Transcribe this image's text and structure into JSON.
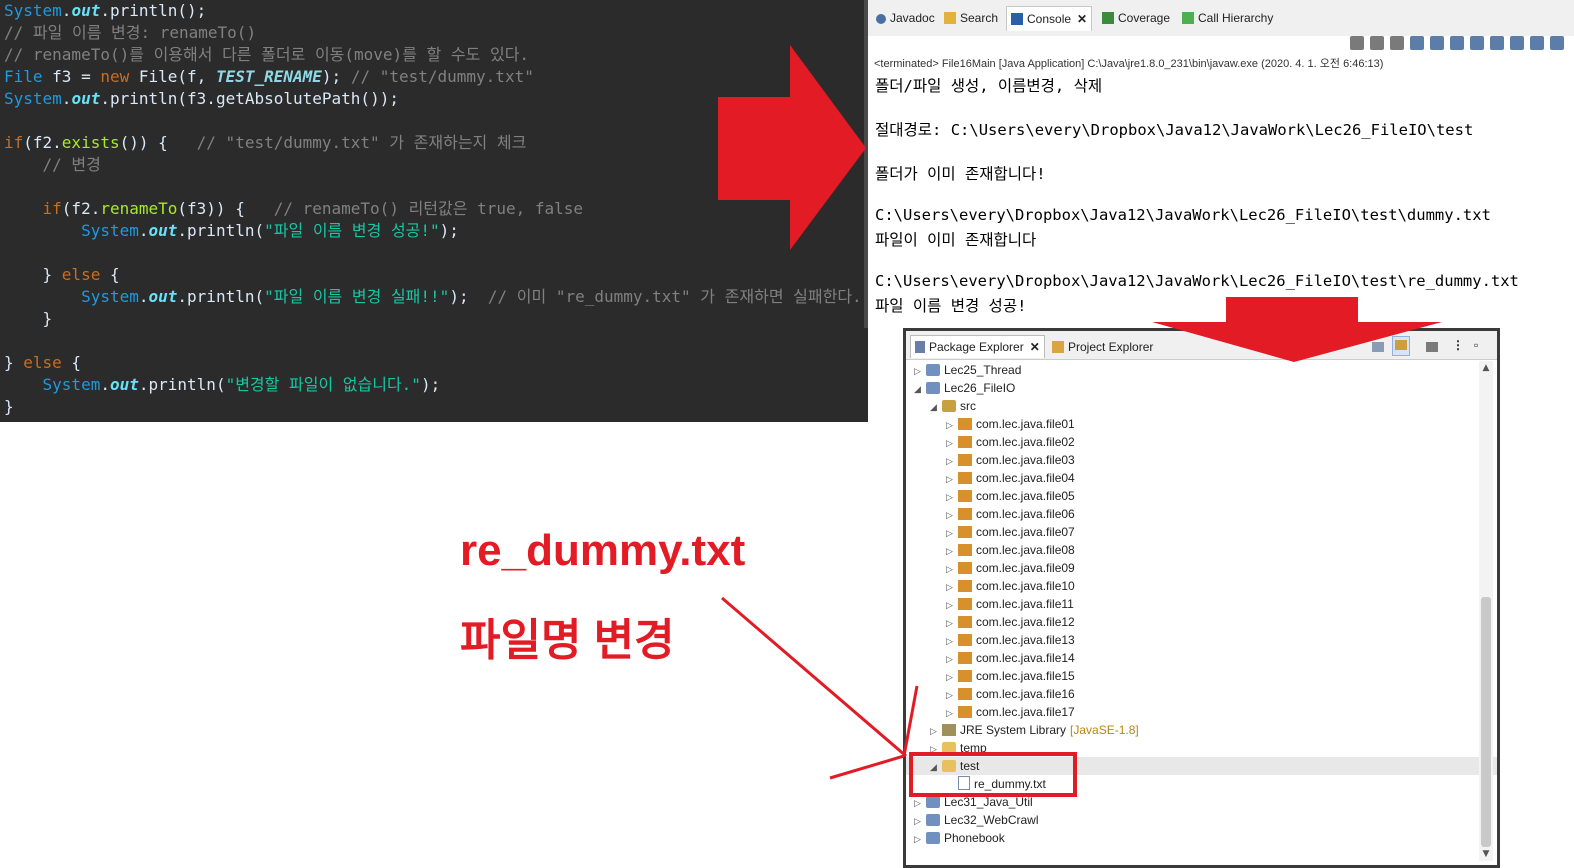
{
  "editor": {
    "lines": [
      {
        "l1": "System",
        "l2": ".",
        "l3": "out",
        "l4": ".println();"
      },
      {
        "comment": "// 파일 이름 변경: renameTo()"
      },
      {
        "comment": "// renameTo()를 이용해서 다른 폴더로 이동(move)를 할 수도 있다."
      },
      {
        "t1": "File",
        "t2": " f3 = ",
        "t3": "new",
        "t4": " File(f, ",
        "t5": "TEST_RENAME",
        "t6": "); ",
        "t7": "// \"test/dummy.txt\""
      },
      {
        "l1": "System",
        "l2": ".",
        "l3": "out",
        "l4": ".println(f3.getAbsolutePath());"
      },
      {
        "k1": "if",
        "k2": "(f2.",
        "k3": "exists",
        "k4": "()) {   ",
        "k5": "// \"test/dummy.txt\" 가 존재하는지 체크"
      },
      {
        "comment": "    // 변경"
      },
      {
        "k1": "    if",
        "k2": "(f2.",
        "k3": "renameTo",
        "k4": "(f3)) {   ",
        "k5": "// renameTo() 리턴값은 true, false"
      },
      {
        "s1": "        System",
        "s2": ".",
        "s3": "out",
        "s4": ".println(",
        "s5": "\"파일 이름 변경 성공!\"",
        "s6": ");"
      },
      {
        "e1": "    } ",
        "e2": "else",
        "e3": " {"
      },
      {
        "s1": "        System",
        "s2": ".",
        "s3": "out",
        "s4": ".println(",
        "s5": "\"파일 이름 변경 실패!!\"",
        "s6": ");  ",
        "s7": "// 이미 \"re_dummy.txt\" 가 존재하면 실패한다."
      },
      {
        "plain": "    }"
      },
      {
        "e1": "} ",
        "e2": "else",
        "e3": " {"
      },
      {
        "s1": "    System",
        "s2": ".",
        "s3": "out",
        "s4": ".println(",
        "s5": "\"변경할 파일이 없습니다.\"",
        "s6": ");"
      },
      {
        "plain": "}"
      }
    ]
  },
  "console": {
    "tabs": {
      "javadoc": "Javadoc",
      "search": "Search",
      "console": "Console",
      "coverage": "Coverage",
      "call_hierarchy": "Call Hierarchy"
    },
    "status": "<terminated> File16Main [Java Application] C:\\Java\\jre1.8.0_231\\bin\\javaw.exe (2020. 4. 1. 오전 6:46:13)",
    "output": [
      "폴더/파일 생성, 이름변경, 삭제",
      "절대경로: C:\\Users\\every\\Dropbox\\Java12\\JavaWork\\Lec26_FileIO\\test",
      "폴더가 이미 존재합니다!",
      "C:\\Users\\every\\Dropbox\\Java12\\JavaWork\\Lec26_FileIO\\test\\dummy.txt",
      "파일이 이미 존재합니다",
      "C:\\Users\\every\\Dropbox\\Java12\\JavaWork\\Lec26_FileIO\\test\\re_dummy.txt",
      "파일 이름 변경 성공!"
    ]
  },
  "explorer": {
    "tabs": {
      "package": "Package Explorer",
      "project": "Project Explorer"
    },
    "items": [
      {
        "label": "Lec25_Thread",
        "twisty": "▷",
        "icon": "project"
      },
      {
        "label": "Lec26_FileIO",
        "twisty": "◢",
        "icon": "project"
      },
      {
        "label": "src",
        "twisty": "◢",
        "icon": "source-folder"
      },
      {
        "label": "com.lec.java.file01",
        "twisty": "▷",
        "icon": "package"
      },
      {
        "label": "com.lec.java.file02",
        "twisty": "▷",
        "icon": "package"
      },
      {
        "label": "com.lec.java.file03",
        "twisty": "▷",
        "icon": "package"
      },
      {
        "label": "com.lec.java.file04",
        "twisty": "▷",
        "icon": "package"
      },
      {
        "label": "com.lec.java.file05",
        "twisty": "▷",
        "icon": "package"
      },
      {
        "label": "com.lec.java.file06",
        "twisty": "▷",
        "icon": "package"
      },
      {
        "label": "com.lec.java.file07",
        "twisty": "▷",
        "icon": "package"
      },
      {
        "label": "com.lec.java.file08",
        "twisty": "▷",
        "icon": "package"
      },
      {
        "label": "com.lec.java.file09",
        "twisty": "▷",
        "icon": "package"
      },
      {
        "label": "com.lec.java.file10",
        "twisty": "▷",
        "icon": "package"
      },
      {
        "label": "com.lec.java.file11",
        "twisty": "▷",
        "icon": "package"
      },
      {
        "label": "com.lec.java.file12",
        "twisty": "▷",
        "icon": "package"
      },
      {
        "label": "com.lec.java.file13",
        "twisty": "▷",
        "icon": "package"
      },
      {
        "label": "com.lec.java.file14",
        "twisty": "▷",
        "icon": "package"
      },
      {
        "label": "com.lec.java.file15",
        "twisty": "▷",
        "icon": "package"
      },
      {
        "label": "com.lec.java.file16",
        "twisty": "▷",
        "icon": "package"
      },
      {
        "label": "com.lec.java.file17",
        "twisty": "▷",
        "icon": "package"
      },
      {
        "label": "JRE System Library",
        "suffix": "[JavaSE-1.8]",
        "twisty": "▷",
        "icon": "library"
      },
      {
        "label": "temp",
        "twisty": "▷",
        "icon": "folder"
      },
      {
        "label": "test",
        "twisty": "◢",
        "icon": "folder"
      },
      {
        "label": "re_dummy.txt",
        "twisty": "",
        "icon": "file"
      },
      {
        "label": "Lec31_Java_Util",
        "twisty": "▷",
        "icon": "project"
      },
      {
        "label": "Lec32_WebCrawl",
        "twisty": "▷",
        "icon": "project"
      },
      {
        "label": "Phonebook",
        "twisty": "▷",
        "icon": "project"
      }
    ]
  },
  "annotation": {
    "line1": "re_dummy.txt",
    "line2": "파일명 변경",
    "color": "#e21b25"
  }
}
